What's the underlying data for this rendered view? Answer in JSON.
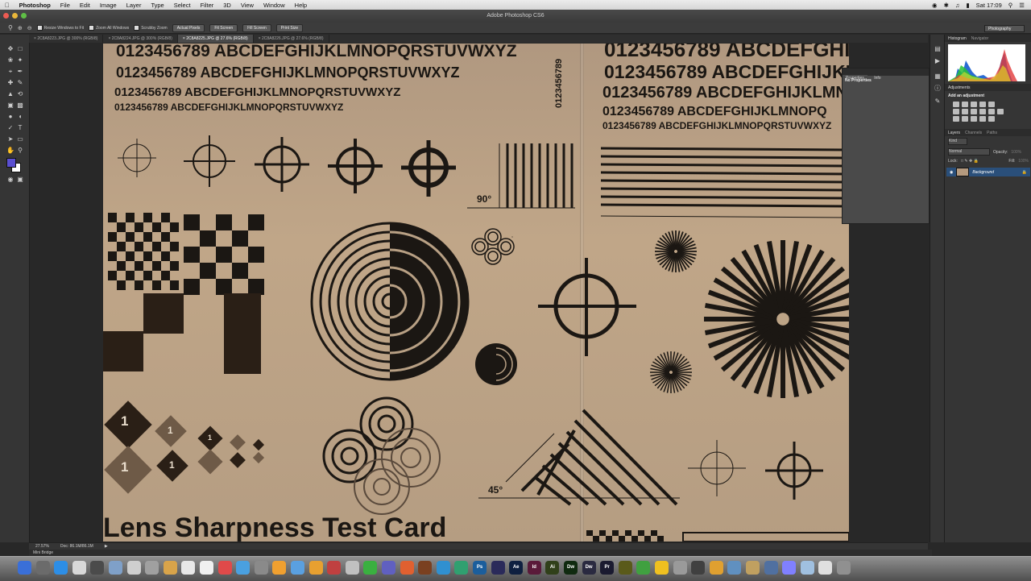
{
  "menubar": {
    "app": "Photoshop",
    "items": [
      "File",
      "Edit",
      "Image",
      "Layer",
      "Type",
      "Select",
      "Filter",
      "3D",
      "View",
      "Window",
      "Help"
    ],
    "clock": "Sat 17:09"
  },
  "window": {
    "title": "Adobe Photoshop CS6"
  },
  "options": {
    "resize_windows": "Resize Windows to Fit",
    "zoom_all": "Zoom All Windows",
    "scrubby": "Scrubby Zoom",
    "actual_pixels": "Actual Pixels",
    "fit_screen": "Fit Screen",
    "fill_screen": "Fill Screen",
    "print_size": "Print Size",
    "workspace": "Photography"
  },
  "tabs": [
    {
      "label": "2C8A8223.JPG @ 300% (RGB/8)"
    },
    {
      "label": "2C8A8224.JPG @ 300% (RGB/8)"
    },
    {
      "label": "2C8A8225.JPG @ 27.6% (RGB/8)"
    },
    {
      "label": "2C8A8226.JPG @ 27.6% (RGB/8)"
    }
  ],
  "canvas": {
    "line1": "0123456789 ABCDEFGHIJKLMNOPQRSTUVWXYZ",
    "line2": "0123456789 ABCDEFGHIJKLMNOPQRSTUVWXYZ",
    "line3": "0123456789 ABCDEFGHIJKLMNOPQRSTUVWXYZ",
    "line4": "0123456789 ABCDEFGHIJKLMNOPQRSTUVWXYZ",
    "r_line1": "0123456789 ABCDEFGHI",
    "r_line2": "0123456789 ABCDEFGHIJKLMN",
    "r_line3": "0123456789 ABCDEFGHIJKLMNOP",
    "r_line4": "0123456789 ABCDEFGHIJKLMNOPQ",
    "r_line5": "0123456789 ABCDEFGHIJKLMNOPQRSTUVWXYZ",
    "vertical_digits": "0123456789",
    "angle90": "90°",
    "angle45": "45°",
    "diamond_num": "1",
    "bottom_title": "Lens Sharpness Test Card"
  },
  "properties": {
    "tab1": "Properties",
    "tab2": "Info",
    "content": "No Properties"
  },
  "panels": {
    "histogram": "Histogram",
    "navigator": "Navigator",
    "adjustments": "Adjustments",
    "add_adjustment": "Add an adjustment",
    "layers": "Layers",
    "channels": "Channels",
    "paths": "Paths",
    "kind": "Kind",
    "blend": "Normal",
    "opacity_label": "Opacity:",
    "opacity": "100%",
    "lock_label": "Lock:",
    "fill_label": "Fill:",
    "fill": "100%",
    "layer_name": "Background"
  },
  "status": {
    "zoom": "27.57%",
    "doc": "Doc: 86.1M/86.1M"
  },
  "minibridge": "Mini Bridge",
  "colors": {
    "foreground": "#5a4fd0",
    "background": "#ffffff",
    "accent": "#2a4f7a"
  }
}
